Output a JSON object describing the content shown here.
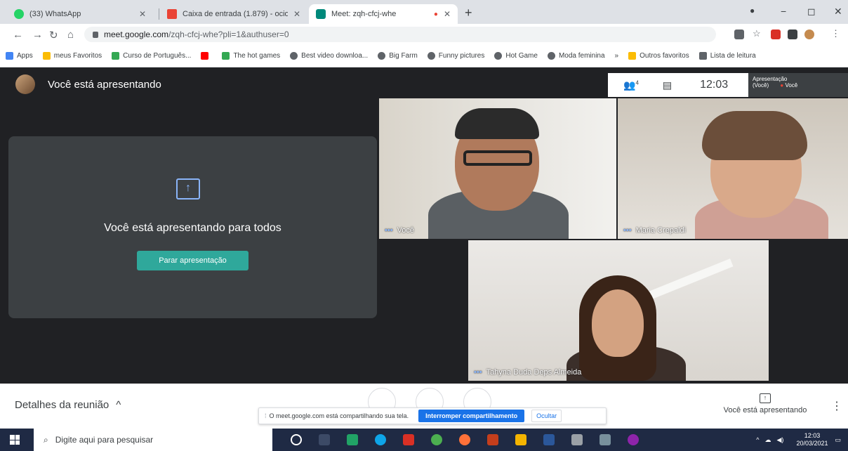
{
  "browser": {
    "tabs": [
      {
        "title": "(33) WhatsApp",
        "icon": "whatsapp-icon",
        "color": "#25d366"
      },
      {
        "title": "Caixa de entrada (1.879) - ocioci",
        "icon": "gmail-icon",
        "color": "#ea4335"
      },
      {
        "title": "Meet: zqh-cfcj-whe",
        "icon": "meet-icon",
        "color": "#00897b"
      }
    ],
    "url_host": "meet.google.com",
    "url_path": "/zqh-cfcj-whe?pli=1&authuser=0",
    "bookmarks": [
      {
        "label": "Apps",
        "color": "#4285f4"
      },
      {
        "label": "meus Favoritos",
        "color": "#fbbc04"
      },
      {
        "label": "Curso de Português...",
        "color": "#34a853"
      },
      {
        "label": "",
        "color": "#ff0000"
      },
      {
        "label": "The hot games",
        "color": "#34a853"
      },
      {
        "label": "Best video downloa...",
        "color": "#5f6368"
      },
      {
        "label": "Big Farm",
        "color": "#5f6368"
      },
      {
        "label": "Funny pictures",
        "color": "#5f6368"
      },
      {
        "label": "Hot Game",
        "color": "#5f6368"
      },
      {
        "label": "Moda feminina",
        "color": "#5f6368"
      },
      {
        "label": "»",
        "color": ""
      },
      {
        "label": "Outros favoritos",
        "color": "#fbbc04"
      },
      {
        "label": "Lista de leitura",
        "color": "#5f6368"
      }
    ]
  },
  "meet": {
    "header_title": "Você está apresentando",
    "time": "12:03",
    "people_count": "4",
    "thumb_label_1": "Apresentação",
    "thumb_label_2": "(Você)",
    "thumb_label_3": "Você",
    "present_card_text": "Você está apresentando para todos",
    "stop_button": "Parar apresentação",
    "participants": [
      {
        "name": "Você"
      },
      {
        "name": "Maria Crepaldi"
      },
      {
        "name": "Tahyna Duda Deps Almeida"
      }
    ],
    "details_label": "Detalhes da reunião",
    "share_notice_text": "O meet.google.com está compartilhando sua tela.",
    "share_stop": "Interromper compartilhamento",
    "share_hide": "Ocultar",
    "you_presenting": "Você está apresentando"
  },
  "taskbar": {
    "search_placeholder": "Digite aqui para pesquisar",
    "clock_time": "12:03",
    "clock_date": "20/03/2021"
  }
}
